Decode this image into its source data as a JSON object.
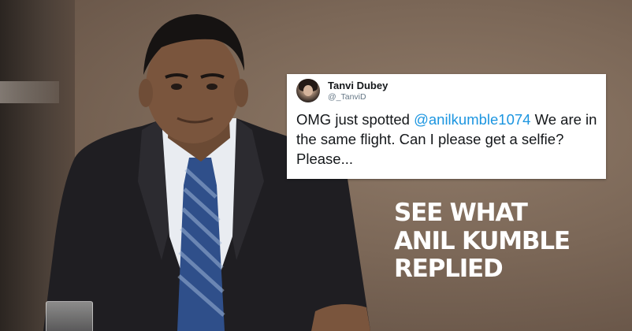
{
  "image": {
    "description": "Anil Kumble sitting, wearing a dark suit with blue striped tie",
    "background_colors": {
      "primary": "#7b6757",
      "dark": "#2b2521"
    }
  },
  "tweet": {
    "user_name": "Tanvi Dubey",
    "user_handle": "@_TanviD",
    "text_before": "OMG just spotted ",
    "mention": "@anilkumble1074",
    "text_after": " We are in the same flight. Can I please get a selfie? Please...",
    "mention_color": "#1b95e0"
  },
  "headline": {
    "lines": [
      "SEE WHAT",
      "ANIL KUMBLE",
      "REPLIED"
    ]
  }
}
